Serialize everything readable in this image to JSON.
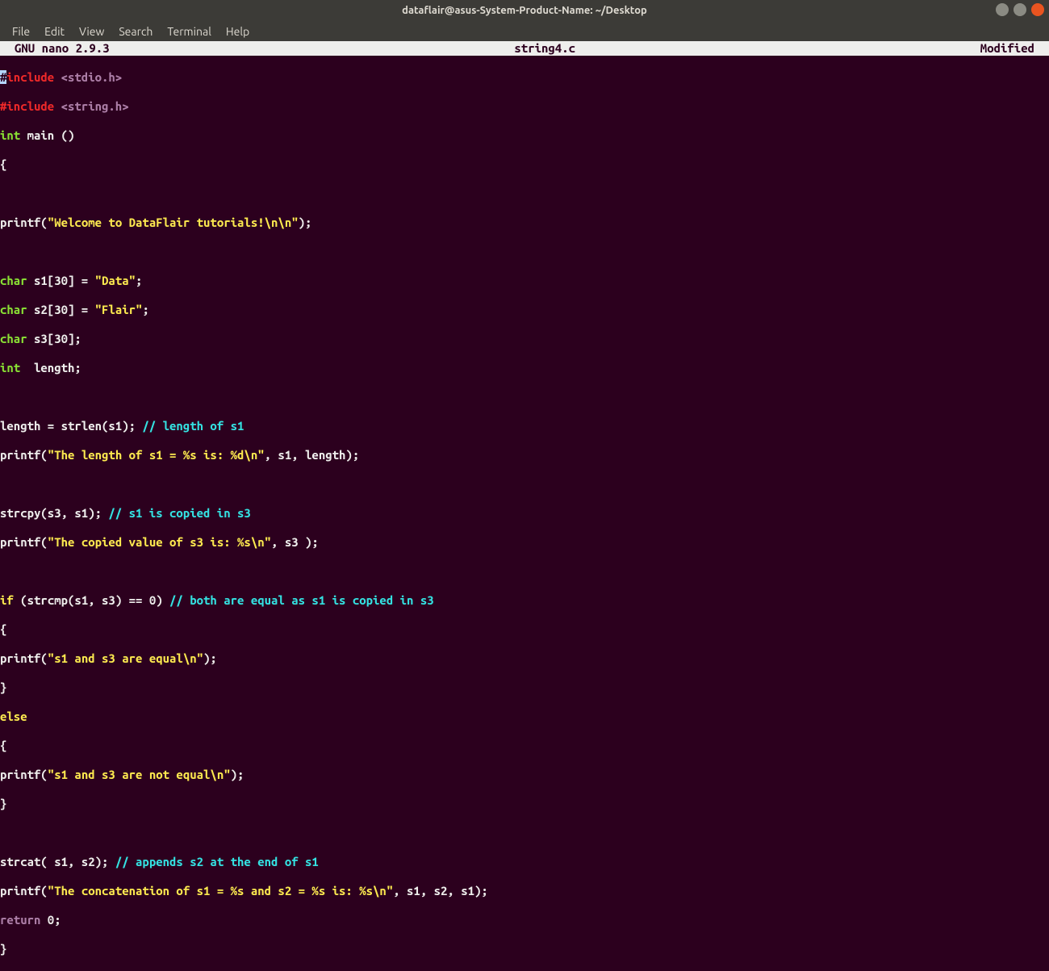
{
  "window": {
    "title": "dataflair@asus-System-Product-Name: ~/Desktop"
  },
  "menubar": {
    "file": "File",
    "edit": "Edit",
    "view": "View",
    "search": "Search",
    "terminal": "Terminal",
    "help": "Help"
  },
  "nano": {
    "version": "GNU nano 2.9.3",
    "filename": "string4.c",
    "status": "Modified"
  },
  "code": {
    "l1a": "#",
    "l1b": "include ",
    "l1c": "<stdio.h>",
    "l2a": "#include ",
    "l2b": "<string.h>",
    "l3a": "int",
    "l3b": " main ()",
    "l4": "{",
    "l6a": "printf(",
    "l6b": "\"Welcome to DataFlair tutorials!\\n\\n\"",
    "l6c": ");",
    "l8a": "char",
    "l8b": " s1[30] = ",
    "l8c": "\"Data\"",
    "l8d": ";",
    "l9a": "char",
    "l9b": " s2[30] = ",
    "l9c": "\"Flair\"",
    "l9d": ";",
    "l10a": "char",
    "l10b": " s3[30];",
    "l11a": "int",
    "l11b": "  length;",
    "l13a": "length = strlen(s1); ",
    "l13b": "// length of s1",
    "l14a": "printf(",
    "l14b": "\"The length of s1 = %s is: %d\\n\"",
    "l14c": ", s1, length);",
    "l16a": "strcpy(s3, s1); ",
    "l16b": "// s1 is copied in s3",
    "l17a": "printf(",
    "l17b": "\"The copied value of s3 is: %s\\n\"",
    "l17c": ", s3 );",
    "l19a": "if",
    "l19b": " (strcmp(s1, s3) == 0) ",
    "l19c": "// both are equal as s1 is copied in s3",
    "l20": "{",
    "l21a": "printf(",
    "l21b": "\"s1 and s3 are equal\\n\"",
    "l21c": ");",
    "l22": "}",
    "l23": "else",
    "l24": "{",
    "l25a": "printf(",
    "l25b": "\"s1 and s3 are not equal\\n\"",
    "l25c": ");",
    "l26": "}",
    "l28a": "strcat( s1, s2); ",
    "l28b": "// appends s2 at the end of s1",
    "l29a": "printf(",
    "l29b": "\"The concatenation of s1 = %s and s2 = %s is: %s\\n\"",
    "l29c": ", s1, s2, s1);",
    "l30a": "return",
    "l30b": " 0;",
    "l31": "}"
  }
}
